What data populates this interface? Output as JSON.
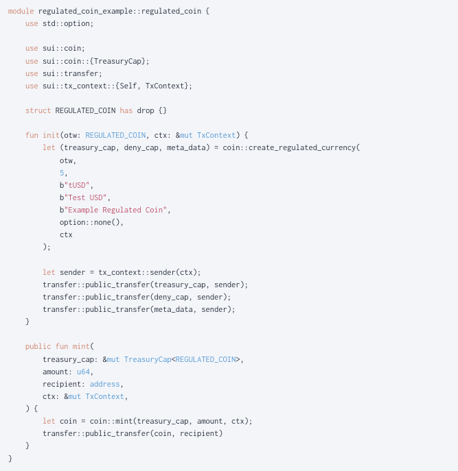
{
  "code": {
    "l1": {
      "kw1": "module",
      "rest": " regulated_coin_example::regulated_coin {"
    },
    "l2": {
      "kw1": "use",
      "rest": " std::option;"
    },
    "l3": {
      "kw1": "use",
      "rest": " sui::coin;"
    },
    "l4": {
      "kw1": "use",
      "rest": " sui::coin::{TreasuryCap};"
    },
    "l5": {
      "kw1": "use",
      "rest": " sui::transfer;"
    },
    "l6": {
      "kw1": "use",
      "rest": " sui::tx_context::{Self, TxContext};"
    },
    "l7": {
      "kw1": "struct",
      "mid": " REGULATED_COIN ",
      "kw2": "has",
      "rest": " drop {}"
    },
    "l8": {
      "kw1": "fun",
      "sp1": " ",
      "fn": "init",
      "p1": "(otw: ",
      "ty1": "REGULATED_COIN",
      "p2": ", ctx: &",
      "ty2": "mut",
      "sp2": " ",
      "ty3": "TxContext",
      "p3": ") {"
    },
    "l9": {
      "kw1": "let",
      "rest": " (treasury_cap, deny_cap, meta_data) = coin::create_regulated_currency("
    },
    "l10": {
      "txt": "otw,"
    },
    "l11": {
      "num": "5",
      "rest": ","
    },
    "l12": {
      "prefix": "b",
      "str": "\"tUSD\"",
      "rest": ","
    },
    "l13": {
      "prefix": "b",
      "str": "\"Test USD\"",
      "rest": ","
    },
    "l14": {
      "prefix": "b",
      "str": "\"Example Regulated Coin\"",
      "rest": ","
    },
    "l15": {
      "txt": "option::none(),"
    },
    "l16": {
      "txt": "ctx"
    },
    "l17": {
      "txt": ");"
    },
    "l18": {
      "kw1": "let",
      "rest": " sender = tx_context::sender(ctx);"
    },
    "l19": {
      "txt": "transfer::public_transfer(treasury_cap, sender);"
    },
    "l20": {
      "txt": "transfer::public_transfer(deny_cap, sender);"
    },
    "l21": {
      "txt": "transfer::public_transfer(meta_data, sender);"
    },
    "l22": {
      "txt": "}"
    },
    "l23": {
      "kw1": "public",
      "sp1": " ",
      "kw2": "fun",
      "sp2": " ",
      "fn": "mint",
      "rest": "("
    },
    "l24": {
      "p1": "treasury_cap: &",
      "ty1": "mut",
      "sp1": " ",
      "ty2": "TreasuryCap",
      "p2": "<",
      "ty3": "REGULATED_COIN",
      "p3": ">,"
    },
    "l25": {
      "p1": "amount: ",
      "ty1": "u64",
      "rest": ","
    },
    "l26": {
      "p1": "recipient: ",
      "ty1": "address",
      "rest": ","
    },
    "l27": {
      "p1": "ctx: &",
      "ty1": "mut",
      "sp1": " ",
      "ty2": "TxContext",
      "rest": ","
    },
    "l28": {
      "txt": ") {"
    },
    "l29": {
      "kw1": "let",
      "rest": " coin = coin::mint(treasury_cap, amount, ctx);"
    },
    "l30": {
      "txt": "transfer::public_transfer(coin, recipient)"
    },
    "l31": {
      "txt": "}"
    },
    "l32": {
      "txt": "}"
    }
  }
}
